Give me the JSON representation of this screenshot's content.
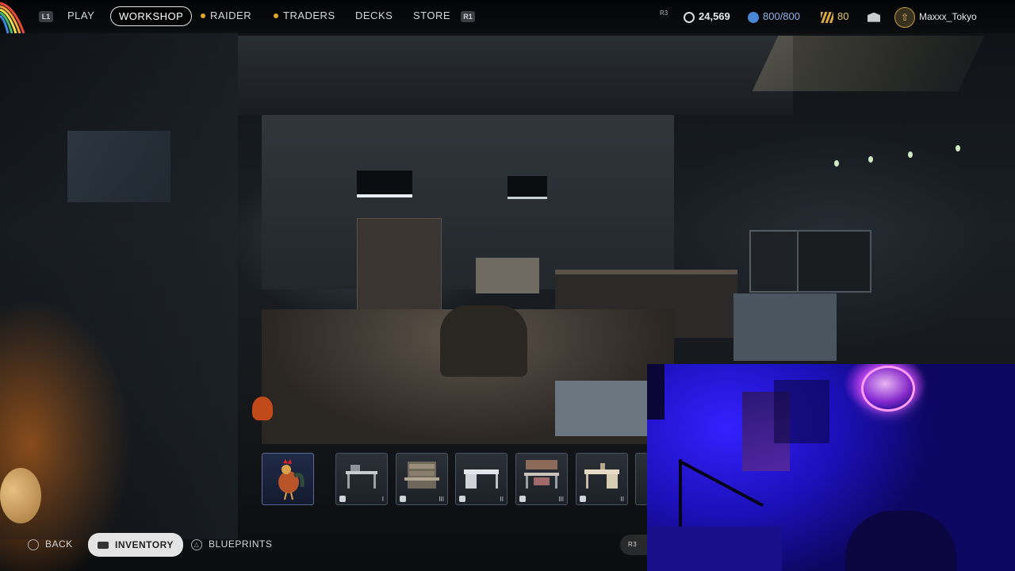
{
  "nav": {
    "left_hint": "L1",
    "right_hint": "R1",
    "tabs": [
      {
        "label": "PLAY",
        "active": false,
        "dot": false
      },
      {
        "label": "WORKSHOP",
        "active": true,
        "dot": false
      },
      {
        "label": "RAIDER",
        "active": false,
        "dot": true
      },
      {
        "label": "TRADERS",
        "active": false,
        "dot": true
      },
      {
        "label": "DECKS",
        "active": false,
        "dot": false
      },
      {
        "label": "STORE",
        "active": false,
        "dot": false
      }
    ]
  },
  "status": {
    "r3_hint": "R3",
    "credits": "24,569",
    "capacity": "800/800",
    "tokens": "80",
    "username": "Maxxx_Tokyo"
  },
  "inventory": {
    "slots": [
      {
        "icon": "rooster-icon"
      },
      {
        "icon": "workbench-icon",
        "level": "I"
      },
      {
        "icon": "workbench-icon",
        "level": "III"
      },
      {
        "icon": "desk-icon",
        "level": "II"
      },
      {
        "icon": "workbench-icon",
        "level": "III"
      },
      {
        "icon": "desk-icon",
        "level": "II"
      }
    ]
  },
  "bottom": {
    "back": "BACK",
    "inventory": "INVENTORY",
    "blueprints": "BLUEPRINTS",
    "r3": "R3"
  },
  "colors": {
    "accent": "#e0a82e",
    "webcam_light": "#3420ff"
  }
}
